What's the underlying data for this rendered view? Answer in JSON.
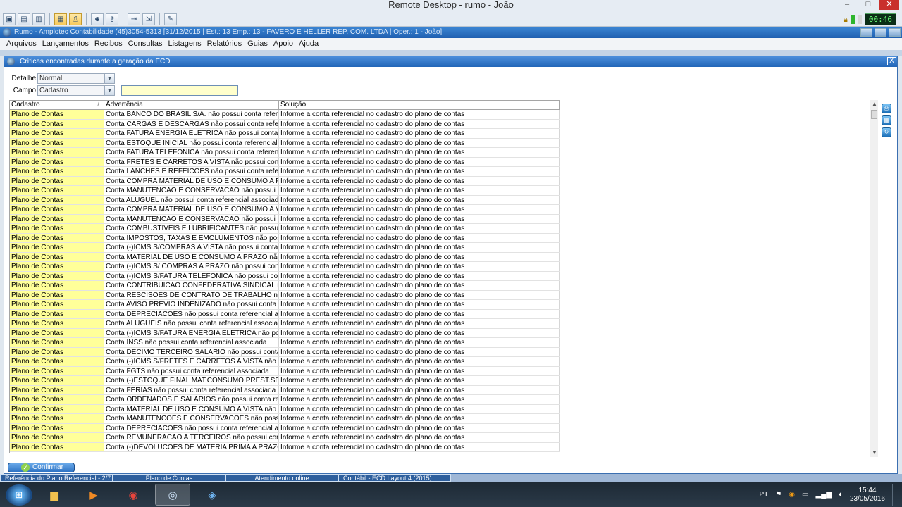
{
  "remote_desktop": {
    "title": "Remote Desktop - rumo - João",
    "minimize": "–",
    "maximize": "□",
    "close": "✕",
    "clock": "00:46"
  },
  "app": {
    "title": "Rumo - Amplotec Contabilidade (45)3054-5313 [31/12/2015 | Est.: 13 Emp.: 13 - FAVERO E HELLER REP. COM. LTDA | Oper.: 1 - João]",
    "menu": [
      "Arquivos",
      "Lançamentos",
      "Recibos",
      "Consultas",
      "Listagens",
      "Relatórios",
      "Guias",
      "Apoio",
      "Ajuda"
    ]
  },
  "dialog": {
    "title": "Críticas encontradas durante a geração da ECD",
    "close": "X",
    "filters": {
      "detalhe_label": "Detalhe",
      "detalhe_value": "Normal",
      "campo_label": "Campo",
      "campo_value": "Cadastro",
      "search_value": ""
    },
    "columns": [
      "Cadastro",
      "Advertência",
      "Solução"
    ],
    "sort_indicator": "/",
    "rows": [
      [
        "Plano de Contas",
        "Conta BANCO DO BRASIL S/A. não possui conta referencial associada",
        "Informe a conta referencial no cadastro do plano de contas"
      ],
      [
        "Plano de Contas",
        "Conta CARGAS E DESCARGAS não possui conta referencial associada",
        "Informe a conta referencial no cadastro do plano de contas"
      ],
      [
        "Plano de Contas",
        "Conta FATURA ENERGIA ELETRICA não possui conta referencial associada",
        "Informe a conta referencial no cadastro do plano de contas"
      ],
      [
        "Plano de Contas",
        "Conta ESTOQUE INICIAL não possui conta referencial associada",
        "Informe a conta referencial no cadastro do plano de contas"
      ],
      [
        "Plano de Contas",
        "Conta FATURA TELEFONICA não possui conta referencial associada",
        "Informe a conta referencial no cadastro do plano de contas"
      ],
      [
        "Plano de Contas",
        "Conta FRETES E CARRETOS A VISTA não possui conta referencial associada",
        "Informe a conta referencial no cadastro do plano de contas"
      ],
      [
        "Plano de Contas",
        "Conta LANCHES E REFEICOES não possui conta referencial associada",
        "Informe a conta referencial no cadastro do plano de contas"
      ],
      [
        "Plano de Contas",
        "Conta COMPRA MATERIAL DE USO E CONSUMO A PRAZO não possui conta referencial associada",
        "Informe a conta referencial no cadastro do plano de contas"
      ],
      [
        "Plano de Contas",
        "Conta MANUTENCAO E CONSERVACAO não possui conta referencial associada",
        "Informe a conta referencial no cadastro do plano de contas"
      ],
      [
        "Plano de Contas",
        "Conta ALUGUEL não possui conta referencial associada",
        "Informe a conta referencial no cadastro do plano de contas"
      ],
      [
        "Plano de Contas",
        "Conta COMPRA MATERIAL DE USO E CONSUMO A VISTA não possui conta referencial associada",
        "Informe a conta referencial no cadastro do plano de contas"
      ],
      [
        "Plano de Contas",
        "Conta MANUTENCAO E CONSERVACAO não possui conta referencial associada",
        "Informe a conta referencial no cadastro do plano de contas"
      ],
      [
        "Plano de Contas",
        "Conta COMBUSTIVEIS E LUBRIFICANTES não possui conta referencial associada",
        "Informe a conta referencial no cadastro do plano de contas"
      ],
      [
        "Plano de Contas",
        "Conta IMPOSTOS, TAXAS E EMOLUMENTOS não possui conta referencial associada",
        "Informe a conta referencial no cadastro do plano de contas"
      ],
      [
        "Plano de Contas",
        "Conta (-)ICMS S/COMPRAS A VISTA não possui conta referencial associada",
        "Informe a conta referencial no cadastro do plano de contas"
      ],
      [
        "Plano de Contas",
        "Conta MATERIAL DE USO E CONSUMO A PRAZO não possui conta referencial associada",
        "Informe a conta referencial no cadastro do plano de contas"
      ],
      [
        "Plano de Contas",
        "Conta (-)ICMS S/ COMPRAS A PRAZO não possui conta referencial associada",
        "Informe a conta referencial no cadastro do plano de contas"
      ],
      [
        "Plano de Contas",
        "Conta (-)ICMS S/FATURA TELEFONICA não possui conta referencial associada",
        "Informe a conta referencial no cadastro do plano de contas"
      ],
      [
        "Plano de Contas",
        "Conta CONTRIBUICAO CONFEDERATIVA SINDICAL não possui conta referencial associada",
        "Informe a conta referencial no cadastro do plano de contas"
      ],
      [
        "Plano de Contas",
        "Conta RESCISOES DE CONTRATO DE TRABALHO não possui conta referencial associada",
        "Informe a conta referencial no cadastro do plano de contas"
      ],
      [
        "Plano de Contas",
        "Conta AVISO PREVIO INDENIZADO não possui conta referencial associada",
        "Informe a conta referencial no cadastro do plano de contas"
      ],
      [
        "Plano de Contas",
        "Conta DEPRECIACOES não possui conta referencial associada",
        "Informe a conta referencial no cadastro do plano de contas"
      ],
      [
        "Plano de Contas",
        "Conta ALUGUEIS não possui conta referencial associada",
        "Informe a conta referencial no cadastro do plano de contas"
      ],
      [
        "Plano de Contas",
        "Conta (-)ICMS S/FATURA ENERGIA ELETRICA não possui conta referencial associada",
        "Informe a conta referencial no cadastro do plano de contas"
      ],
      [
        "Plano de Contas",
        "Conta INSS não possui conta referencial associada",
        "Informe a conta referencial no cadastro do plano de contas"
      ],
      [
        "Plano de Contas",
        "Conta DECIMO TERCEIRO SALARIO não possui conta referencial associada",
        "Informe a conta referencial no cadastro do plano de contas"
      ],
      [
        "Plano de Contas",
        "Conta (-)ICMS S/FRETES E CARRETOS A VISTA não possui conta referencial associada",
        "Informe a conta referencial no cadastro do plano de contas"
      ],
      [
        "Plano de Contas",
        "Conta FGTS não possui conta referencial associada",
        "Informe a conta referencial no cadastro do plano de contas"
      ],
      [
        "Plano de Contas",
        "Conta (-)ESTOQUE FINAL MAT.CONSUMO PREST.SERV. não possui conta referencial associada",
        "Informe a conta referencial no cadastro do plano de contas"
      ],
      [
        "Plano de Contas",
        "Conta FERIAS não possui conta referencial associada",
        "Informe a conta referencial no cadastro do plano de contas"
      ],
      [
        "Plano de Contas",
        "Conta ORDENADOS E SALARIOS não possui conta referencial associada",
        "Informe a conta referencial no cadastro do plano de contas"
      ],
      [
        "Plano de Contas",
        "Conta MATERIAL DE USO E CONSUMO A VISTA não possui conta referencial associada",
        "Informe a conta referencial no cadastro do plano de contas"
      ],
      [
        "Plano de Contas",
        "Conta MANUTENCOES E CONSERVACOES não possui conta referencial associada",
        "Informe a conta referencial no cadastro do plano de contas"
      ],
      [
        "Plano de Contas",
        "Conta DEPRECIACOES não possui conta referencial associada",
        "Informe a conta referencial no cadastro do plano de contas"
      ],
      [
        "Plano de Contas",
        "Conta REMUNERACAO A TERCEIROS não possui conta referencial associada",
        "Informe a conta referencial no cadastro do plano de contas"
      ],
      [
        "Plano de Contas",
        "Conta (-)DEVOLUCOES DE MATERIA PRIMA A PRAZO não possui conta referencial associada",
        "Informe a conta referencial no cadastro do plano de contas"
      ]
    ],
    "confirm_label": "Confirmar"
  },
  "app_tabs": [
    "Referência do Plano Referencial - 2/7",
    "Plano de Contas",
    "Atendimento online",
    "Contábil - ECD Layout 4 (2015)"
  ],
  "taskbar": {
    "language": "PT",
    "time": "15:44",
    "date": "23/05/2016"
  },
  "colors": {
    "highlight_cell": "#ffff99",
    "title_blue": "#2366b8"
  }
}
